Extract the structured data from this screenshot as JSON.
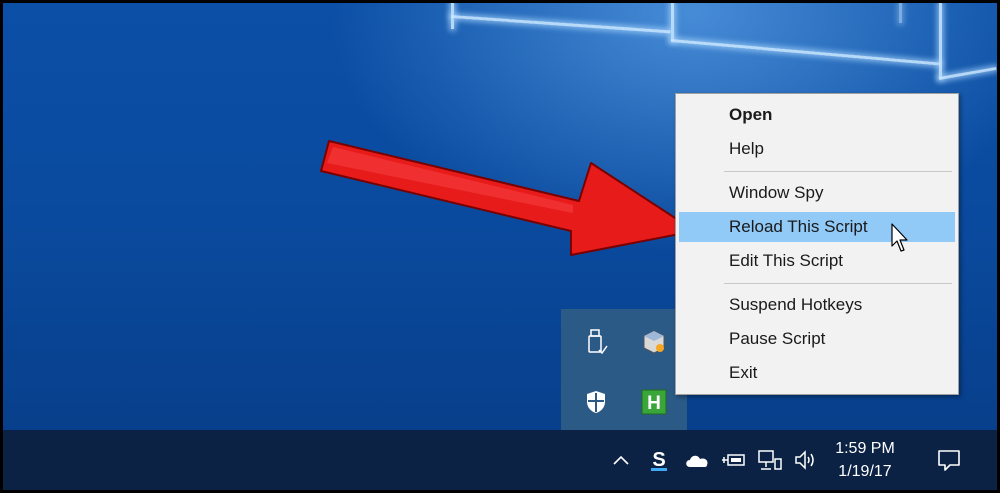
{
  "context_menu": {
    "items": [
      {
        "label": "Open",
        "bold": true
      },
      {
        "label": "Help"
      },
      {
        "label": "Window Spy"
      },
      {
        "label": "Reload This Script",
        "highlighted": true
      },
      {
        "label": "Edit This Script"
      },
      {
        "label": "Suspend Hotkeys"
      },
      {
        "label": "Pause Script"
      },
      {
        "label": "Exit"
      }
    ]
  },
  "tray_overflow": {
    "icons": [
      "usb-eject-icon",
      "virtualbox-icon",
      "windows-defender-shield-icon",
      "autohotkey-h-icon"
    ]
  },
  "taskbar": {
    "tray_icons": [
      "show-hidden-icons-chevron-icon",
      "snagit-s-icon",
      "onedrive-cloud-icon",
      "power-plug-icon",
      "network-icon",
      "volume-icon"
    ],
    "clock": {
      "time": "1:59 PM",
      "date": "1/19/17"
    },
    "action_center_icon": "action-center-icon"
  },
  "colors": {
    "desktop_blue": "#0a4a9e",
    "menu_bg": "#f2f2f2",
    "menu_highlight": "#91c9f7",
    "taskbar_bg": "#0b2244",
    "tray_panel_bg": "#2b5a87",
    "annotation_arrow": "#e81b1b"
  }
}
